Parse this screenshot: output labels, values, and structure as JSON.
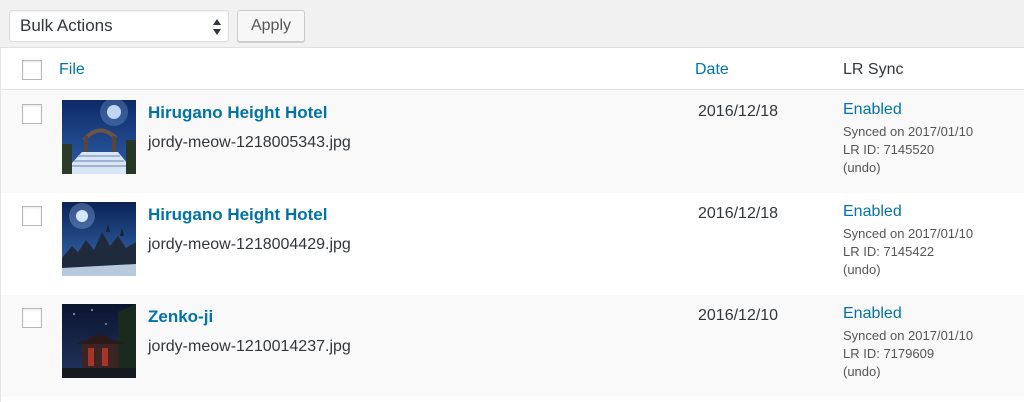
{
  "toolbar": {
    "bulk_actions_value": "Bulk Actions",
    "apply_label": "Apply"
  },
  "columns": {
    "file": "File",
    "date": "Date",
    "lr_sync": "LR Sync"
  },
  "rows": [
    {
      "title": "Hirugano Height Hotel",
      "filename": "jordy-meow-1218005343.jpg",
      "date": "2016/12/18",
      "status": "Enabled",
      "synced": "Synced on 2017/01/10",
      "lr_id": "LR ID: 7145520",
      "undo": "(undo)",
      "thumb_icon": "photo-bridge-night"
    },
    {
      "title": "Hirugano Height Hotel",
      "filename": "jordy-meow-1218004429.jpg",
      "date": "2016/12/18",
      "status": "Enabled",
      "synced": "Synced on 2017/01/10",
      "lr_id": "LR ID: 7145422",
      "undo": "(undo)",
      "thumb_icon": "photo-moon-forest"
    },
    {
      "title": "Zenko-ji",
      "filename": "jordy-meow-1210014237.jpg",
      "date": "2016/12/10",
      "status": "Enabled",
      "synced": "Synced on 2017/01/10",
      "lr_id": "LR ID: 7179609",
      "undo": "(undo)",
      "thumb_icon": "photo-temple-night"
    }
  ],
  "colors": {
    "link": "#0073aa",
    "text": "#32373c",
    "page_bg": "#f1f1f1",
    "alt_row": "#f9f9f9"
  }
}
